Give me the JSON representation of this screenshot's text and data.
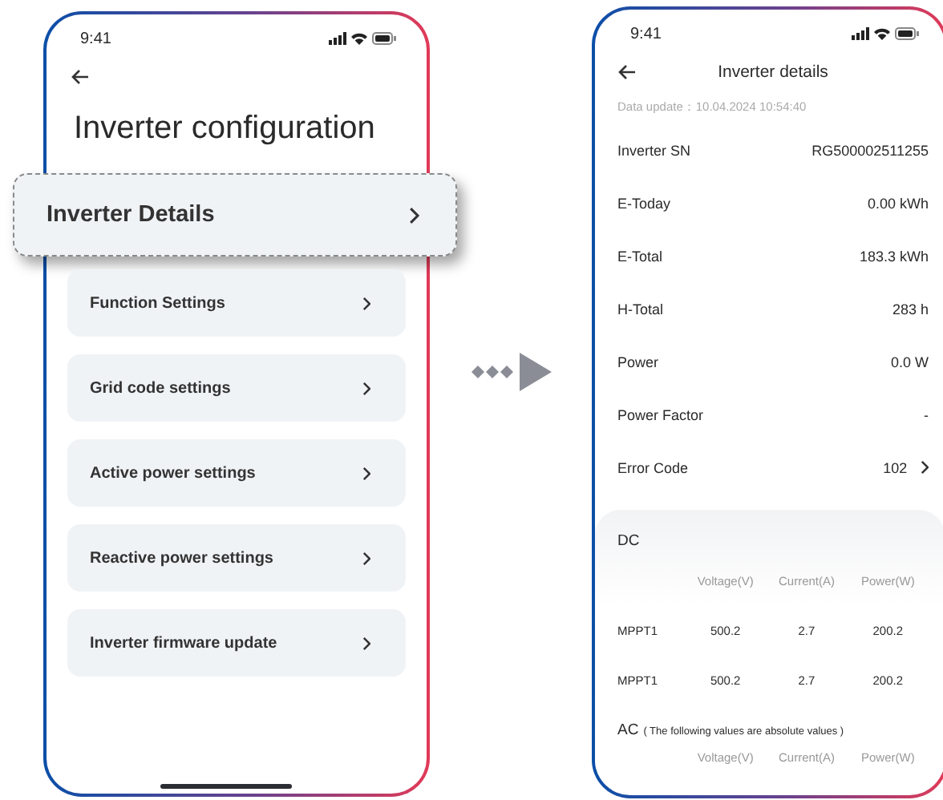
{
  "config_screen": {
    "status_time": "9:41",
    "title": "Inverter configuration",
    "items": [
      {
        "label": "Inverter Details",
        "highlighted": true
      },
      {
        "label": "Function Settings",
        "highlighted": false
      },
      {
        "label": "Grid code settings",
        "highlighted": false
      },
      {
        "label": "Active power settings",
        "highlighted": false
      },
      {
        "label": "Reactive power settings",
        "highlighted": false
      },
      {
        "label": "Inverter firmware update",
        "highlighted": false
      }
    ]
  },
  "details_screen": {
    "status_time": "9:41",
    "title": "Inverter details",
    "data_update": "Data update：10.04.2024 10:54:40",
    "rows": [
      {
        "label": "Inverter SN",
        "value": "RG500002511255",
        "kind": "plain"
      },
      {
        "label": "E-Today",
        "value": "0.00 kWh",
        "kind": "plain"
      },
      {
        "label": "E-Total",
        "value": "183.3 kWh",
        "kind": "plain"
      },
      {
        "label": "H-Total",
        "value": "283 h",
        "kind": "plain"
      },
      {
        "label": "Power",
        "value": "0.0 W",
        "kind": "plain"
      },
      {
        "label": "Power Factor",
        "value": "-",
        "kind": "plain"
      },
      {
        "label": "Error Code",
        "value": "102",
        "kind": "link"
      }
    ],
    "dc": {
      "title": "DC",
      "columns": [
        "Voltage(V)",
        "Current(A)",
        "Power(W)"
      ],
      "rows": [
        {
          "label": "MPPT1",
          "values": [
            "500.2",
            "2.7",
            "200.2"
          ]
        },
        {
          "label": "MPPT1",
          "values": [
            "500.2",
            "2.7",
            "200.2"
          ]
        }
      ]
    },
    "ac": {
      "title": "AC",
      "note": "( The following values are absolute values )",
      "columns": [
        "Voltage(V)",
        "Current(A)",
        "Power(W)"
      ]
    }
  }
}
